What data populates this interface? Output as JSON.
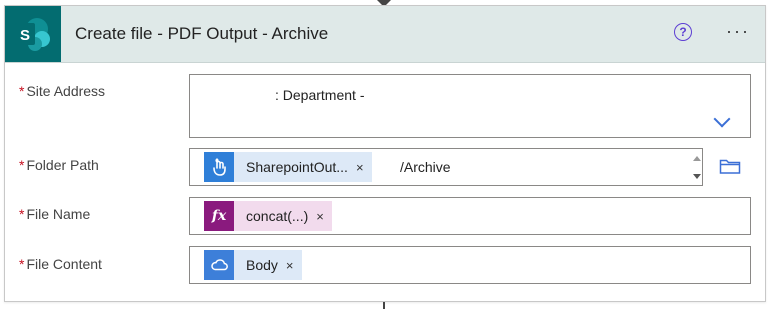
{
  "action": {
    "title": "Create file - PDF Output - Archive",
    "help_icon": "help-circle-icon",
    "more_icon": "ellipsis-icon",
    "more_glyph": "···",
    "help_glyph": "?"
  },
  "fields": {
    "required_marker": "*",
    "site_address": {
      "label": "Site Address",
      "value": ": Department -"
    },
    "folder_path": {
      "label": "Folder Path",
      "token_label": "SharepointOut...",
      "token_icon": "hand-pointer-icon",
      "suffix": "/Archive"
    },
    "file_name": {
      "label": "File Name",
      "token_label": "concat(...)",
      "token_icon": "fx-icon"
    },
    "file_content": {
      "label": "File Content",
      "token_label": "Body",
      "token_icon": "onedrive-cloud-icon"
    }
  },
  "token_close_glyph": "×",
  "colors": {
    "header_bg": "#dfe9e8",
    "sharepoint_teal": "#036c70",
    "required_red": "#c50f1f",
    "accent_blue": "#3b6fd6"
  }
}
